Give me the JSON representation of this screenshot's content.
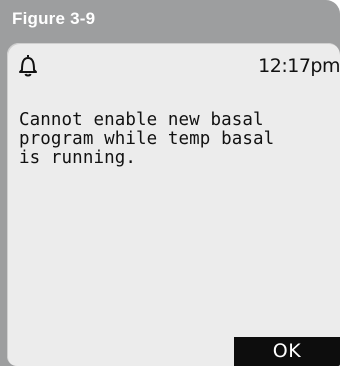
{
  "figure": {
    "label": "Figure 3-9"
  },
  "screen": {
    "alert_icon": "bell-icon",
    "time": "12:17pm",
    "message": "Cannot enable new basal\nprogram while temp basal\nis running.",
    "ok_label": "OK"
  },
  "colors": {
    "frame": "#9d9e9f",
    "screen_bg": "#ececec",
    "button_bg": "#0d0d0d",
    "text": "#111111"
  }
}
